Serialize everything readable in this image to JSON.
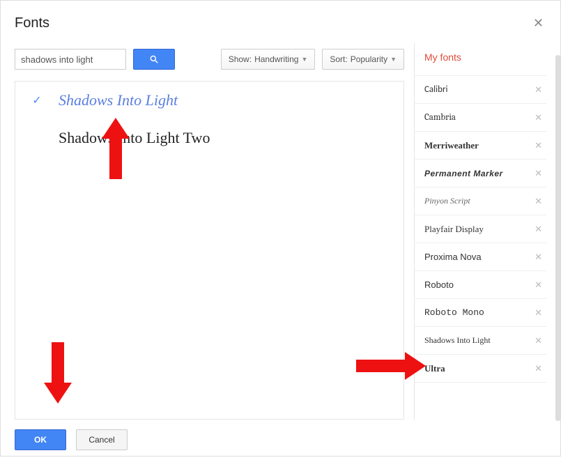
{
  "dialog": {
    "title": "Fonts"
  },
  "search": {
    "value": "shadows into light"
  },
  "filters": {
    "show_prefix": "Show: ",
    "show_value": "Handwriting",
    "sort_prefix": "Sort: ",
    "sort_value": "Popularity"
  },
  "results": [
    {
      "name": "Shadows Into Light",
      "selected": true,
      "css": "font-shadows"
    },
    {
      "name": "Shadows Into Light Two",
      "selected": false,
      "css": "font-shadows-two"
    }
  ],
  "myfonts": {
    "title": "My fonts",
    "items": [
      {
        "name": "Calibri",
        "css": "f-calibri"
      },
      {
        "name": "Cambria",
        "css": "f-cambria"
      },
      {
        "name": "Merriweather",
        "css": "f-merri"
      },
      {
        "name": "Permanent Marker",
        "css": "f-perm"
      },
      {
        "name": "Pinyon Script",
        "css": "f-pinyon"
      },
      {
        "name": "Playfair Display",
        "css": "f-playfair"
      },
      {
        "name": "Proxima Nova",
        "css": "f-proxima"
      },
      {
        "name": "Roboto",
        "css": "f-roboto"
      },
      {
        "name": "Roboto Mono",
        "css": "f-robotomono"
      },
      {
        "name": "Shadows Into Light",
        "css": "f-shadows"
      },
      {
        "name": "Ultra",
        "css": "f-ultra"
      }
    ]
  },
  "buttons": {
    "ok": "OK",
    "cancel": "Cancel"
  }
}
